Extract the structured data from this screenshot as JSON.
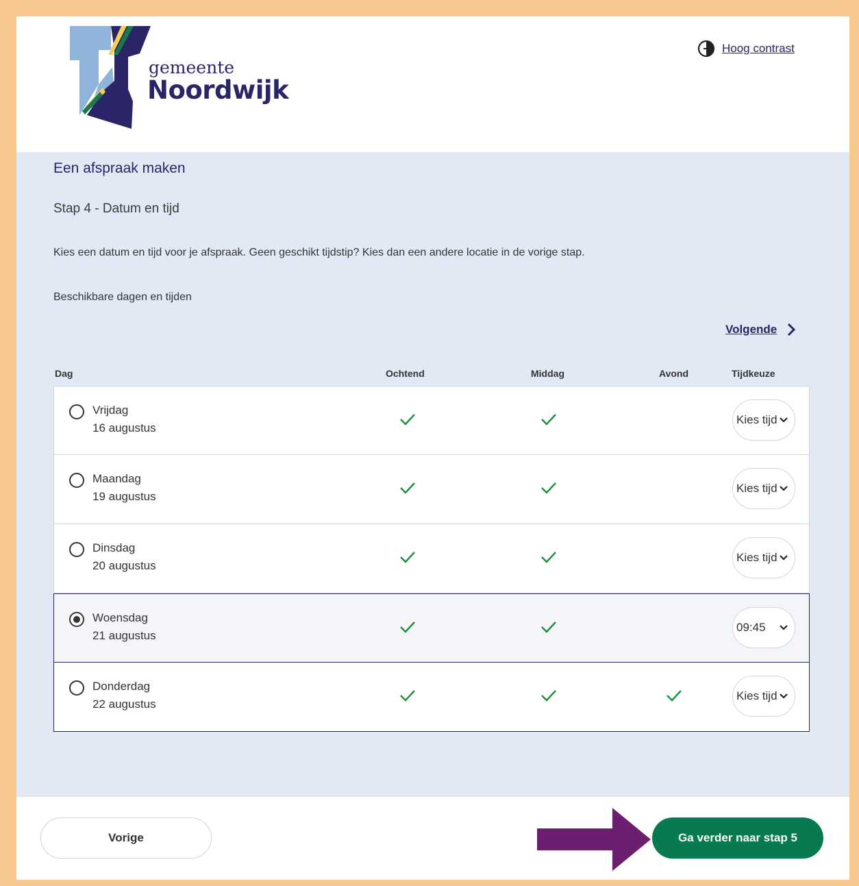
{
  "header": {
    "logo_small": "gemeente",
    "logo_big": "Noordwijk",
    "contrast_link": "Hoog contrast",
    "contrast_icon": "contrast-icon"
  },
  "main": {
    "title": "Een afspraak maken",
    "step": "Stap 4 - Datum en tijd",
    "intro": "Kies een datum en tijd voor je afspraak. Geen geschikt tijdstip? Kies dan een andere locatie in de vorige stap.",
    "available_label": "Beschikbare dagen en tijden",
    "next_link": "Volgende",
    "columns": {
      "day": "Dag",
      "morning": "Ochtend",
      "afternoon": "Middag",
      "evening": "Avond",
      "time_choice": "Tijdkeuze"
    },
    "rows": [
      {
        "day": "Vrijdag",
        "date": "16 augustus",
        "morning": true,
        "afternoon": true,
        "evening": false,
        "time": "Kies tijd",
        "selected": false
      },
      {
        "day": "Maandag",
        "date": "19 augustus",
        "morning": true,
        "afternoon": true,
        "evening": false,
        "time": "Kies tijd",
        "selected": false
      },
      {
        "day": "Dinsdag",
        "date": "20 augustus",
        "morning": true,
        "afternoon": true,
        "evening": false,
        "time": "Kies tijd",
        "selected": false
      },
      {
        "day": "Woensdag",
        "date": "21 augustus",
        "morning": true,
        "afternoon": true,
        "evening": false,
        "time": "09:45",
        "selected": true
      },
      {
        "day": "Donderdag",
        "date": "22 augustus",
        "morning": true,
        "afternoon": true,
        "evening": true,
        "time": "Kies tijd",
        "selected": false
      }
    ]
  },
  "footer": {
    "prev_label": "Vorige",
    "next_label": "Ga verder naar stap 5"
  },
  "colors": {
    "brand": "#2a2566",
    "accent_green": "#077a50",
    "check_green": "#1a8f3c",
    "annotation_arrow": "#6b1f6e",
    "frame": "#f7c98e"
  }
}
